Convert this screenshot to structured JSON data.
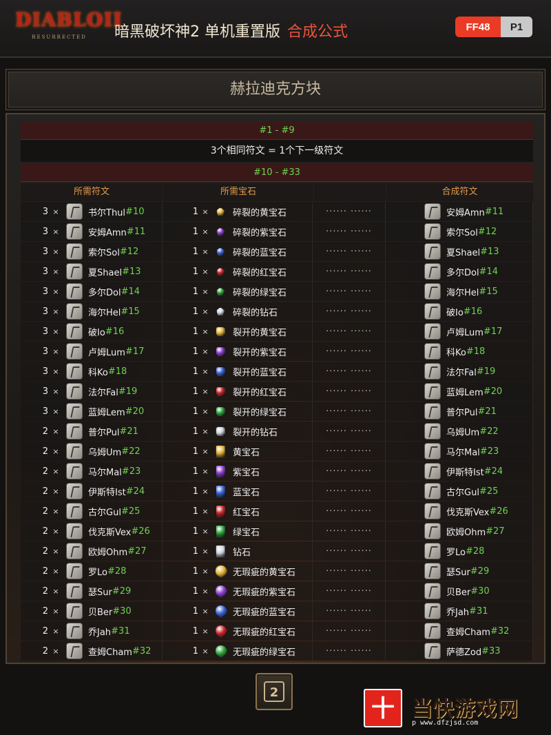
{
  "header": {
    "logo_main": "DIABLO",
    "logo_numeral": "II",
    "logo_sub": "RESURRECTED",
    "title": "暗黑破坏神2 单机重置版",
    "title_accent": "合成公式",
    "badge_left": "FF48",
    "badge_right": "P1"
  },
  "section_title": "赫拉迪克方块",
  "group1": {
    "range": "#1 - #9",
    "rule": "3个相同符文 = 1个下一级符文"
  },
  "group2": {
    "range": "#10 - #33",
    "columns": [
      "所需符文",
      "所需宝石",
      "合成符文"
    ]
  },
  "colors": {
    "accent_green": "#6fd34f",
    "header_orange": "#e39a4a",
    "banner_red": "#3a1818",
    "badge_red": "#ea3b26"
  },
  "rows": [
    {
      "qty": "3",
      "mul": "×",
      "rune": "书尔Thul",
      "num": "#10",
      "gem_qty": "1",
      "gem_mul": "×",
      "gem": "碎裂的黄宝石",
      "gem_color": "#e2b437",
      "gem_grade": "chipped",
      "dots": "······ ······",
      "out": "安姆Amn",
      "out_num": "#11"
    },
    {
      "qty": "3",
      "mul": "×",
      "rune": "安姆Amn",
      "num": "#11",
      "gem_qty": "1",
      "gem_mul": "×",
      "gem": "碎裂的紫宝石",
      "gem_color": "#8d3ed0",
      "gem_grade": "chipped",
      "dots": "······ ······",
      "out": "索尔Sol",
      "out_num": "#12"
    },
    {
      "qty": "3",
      "mul": "×",
      "rune": "索尔Sol",
      "num": "#12",
      "gem_qty": "1",
      "gem_mul": "×",
      "gem": "碎裂的蓝宝石",
      "gem_color": "#3c64d8",
      "gem_grade": "chipped",
      "dots": "······ ······",
      "out": "夏Shael",
      "out_num": "#13"
    },
    {
      "qty": "3",
      "mul": "×",
      "rune": "夏Shael",
      "num": "#13",
      "gem_qty": "1",
      "gem_mul": "×",
      "gem": "碎裂的红宝石",
      "gem_color": "#c8262a",
      "gem_grade": "chipped",
      "dots": "······ ······",
      "out": "多尔Dol",
      "out_num": "#14"
    },
    {
      "qty": "3",
      "mul": "×",
      "rune": "多尔Dol",
      "num": "#14",
      "gem_qty": "1",
      "gem_mul": "×",
      "gem": "碎裂的绿宝石",
      "gem_color": "#2fa63c",
      "gem_grade": "chipped",
      "dots": "······ ······",
      "out": "海尔Hel",
      "out_num": "#15"
    },
    {
      "qty": "3",
      "mul": "×",
      "rune": "海尔Hel",
      "num": "#15",
      "gem_qty": "1",
      "gem_mul": "×",
      "gem": "碎裂的钻石",
      "gem_color": "#cfd4dc",
      "gem_grade": "chipped",
      "dots": "······ ······",
      "out": "破Io",
      "out_num": "#16"
    },
    {
      "qty": "3",
      "mul": "×",
      "rune": "破Io",
      "num": "#16",
      "gem_qty": "1",
      "gem_mul": "×",
      "gem": "裂开的黄宝石",
      "gem_color": "#e2b437",
      "gem_grade": "flawed",
      "dots": "······ ······",
      "out": "卢姆Lum",
      "out_num": "#17"
    },
    {
      "qty": "3",
      "mul": "×",
      "rune": "卢姆Lum",
      "num": "#17",
      "gem_qty": "1",
      "gem_mul": "×",
      "gem": "裂开的紫宝石",
      "gem_color": "#8d3ed0",
      "gem_grade": "flawed",
      "dots": "······ ······",
      "out": "科Ko",
      "out_num": "#18"
    },
    {
      "qty": "3",
      "mul": "×",
      "rune": "科Ko",
      "num": "#18",
      "gem_qty": "1",
      "gem_mul": "×",
      "gem": "裂开的蓝宝石",
      "gem_color": "#3c64d8",
      "gem_grade": "flawed",
      "dots": "······ ······",
      "out": "法尔Fal",
      "out_num": "#19"
    },
    {
      "qty": "3",
      "mul": "×",
      "rune": "法尔Fal",
      "num": "#19",
      "gem_qty": "1",
      "gem_mul": "×",
      "gem": "裂开的红宝石",
      "gem_color": "#c8262a",
      "gem_grade": "flawed",
      "dots": "······ ······",
      "out": "蓝姆Lem",
      "out_num": "#20"
    },
    {
      "qty": "3",
      "mul": "×",
      "rune": "蓝姆Lem",
      "num": "#20",
      "gem_qty": "1",
      "gem_mul": "×",
      "gem": "裂开的绿宝石",
      "gem_color": "#2fa63c",
      "gem_grade": "flawed",
      "dots": "······ ······",
      "out": "普尔Pul",
      "out_num": "#21"
    },
    {
      "qty": "2",
      "mul": "×",
      "rune": "普尔Pul",
      "num": "#21",
      "gem_qty": "1",
      "gem_mul": "×",
      "gem": "裂开的钻石",
      "gem_color": "#cfd4dc",
      "gem_grade": "flawed",
      "dots": "······ ······",
      "out": "乌姆Um",
      "out_num": "#22"
    },
    {
      "qty": "2",
      "mul": "×",
      "rune": "乌姆Um",
      "num": "#22",
      "gem_qty": "1",
      "gem_mul": "×",
      "gem": "黄宝石",
      "gem_color": "#e2b437",
      "gem_grade": "normal",
      "dots": "······ ······",
      "out": "马尔Mal",
      "out_num": "#23"
    },
    {
      "qty": "2",
      "mul": "×",
      "rune": "马尔Mal",
      "num": "#23",
      "gem_qty": "1",
      "gem_mul": "×",
      "gem": "紫宝石",
      "gem_color": "#8d3ed0",
      "gem_grade": "normal",
      "dots": "······ ······",
      "out": "伊斯特Ist",
      "out_num": "#24"
    },
    {
      "qty": "2",
      "mul": "×",
      "rune": "伊斯特Ist",
      "num": "#24",
      "gem_qty": "1",
      "gem_mul": "×",
      "gem": "蓝宝石",
      "gem_color": "#3c64d8",
      "gem_grade": "normal",
      "dots": "······ ······",
      "out": "古尔Gul",
      "out_num": "#25"
    },
    {
      "qty": "2",
      "mul": "×",
      "rune": "古尔Gul",
      "num": "#25",
      "gem_qty": "1",
      "gem_mul": "×",
      "gem": "红宝石",
      "gem_color": "#c8262a",
      "gem_grade": "normal",
      "dots": "······ ······",
      "out": "伐克斯Vex",
      "out_num": "#26"
    },
    {
      "qty": "2",
      "mul": "×",
      "rune": "伐克斯Vex",
      "num": "#26",
      "gem_qty": "1",
      "gem_mul": "×",
      "gem": "绿宝石",
      "gem_color": "#2fa63c",
      "gem_grade": "normal",
      "dots": "······ ······",
      "out": "欧姆Ohm",
      "out_num": "#27"
    },
    {
      "qty": "2",
      "mul": "×",
      "rune": "欧姆Ohm",
      "num": "#27",
      "gem_qty": "1",
      "gem_mul": "×",
      "gem": "钻石",
      "gem_color": "#cfd4dc",
      "gem_grade": "normal",
      "dots": "······ ······",
      "out": "罗Lo",
      "out_num": "#28"
    },
    {
      "qty": "2",
      "mul": "×",
      "rune": "罗Lo",
      "num": "#28",
      "gem_qty": "1",
      "gem_mul": "×",
      "gem": "无瑕疵的黄宝石",
      "gem_color": "#e2b437",
      "gem_grade": "flawless",
      "dots": "······ ······",
      "out": "瑟Sur",
      "out_num": "#29"
    },
    {
      "qty": "2",
      "mul": "×",
      "rune": "瑟Sur",
      "num": "#29",
      "gem_qty": "1",
      "gem_mul": "×",
      "gem": "无瑕疵的紫宝石",
      "gem_color": "#8d3ed0",
      "gem_grade": "flawless",
      "dots": "······ ······",
      "out": "贝Ber",
      "out_num": "#30"
    },
    {
      "qty": "2",
      "mul": "×",
      "rune": "贝Ber",
      "num": "#30",
      "gem_qty": "1",
      "gem_mul": "×",
      "gem": "无瑕疵的蓝宝石",
      "gem_color": "#3c64d8",
      "gem_grade": "flawless",
      "dots": "······ ······",
      "out": "乔Jah",
      "out_num": "#31"
    },
    {
      "qty": "2",
      "mul": "×",
      "rune": "乔Jah",
      "num": "#31",
      "gem_qty": "1",
      "gem_mul": "×",
      "gem": "无瑕疵的红宝石",
      "gem_color": "#c8262a",
      "gem_grade": "flawless",
      "dots": "······ ······",
      "out": "查姆Cham",
      "out_num": "#32"
    },
    {
      "qty": "2",
      "mul": "×",
      "rune": "查姆Cham",
      "num": "#32",
      "gem_qty": "1",
      "gem_mul": "×",
      "gem": "无瑕疵的绿宝石",
      "gem_color": "#2fa63c",
      "gem_grade": "flawless",
      "dots": "······ ······",
      "out": "萨德Zod",
      "out_num": "#33"
    }
  ],
  "footer": {
    "button_icon": "rune-cube-icon",
    "button_glyph": "2"
  },
  "watermark": {
    "badge_glyph": "十",
    "text": "当快游戏网",
    "url": "p www.dfzjsd.com"
  }
}
